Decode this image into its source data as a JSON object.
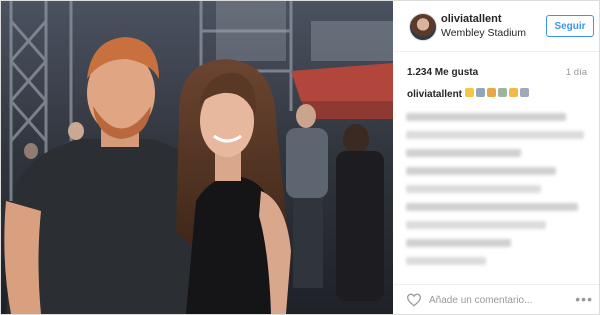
{
  "post": {
    "photo_alt_icon": "photo-icon",
    "header": {
      "username": "oliviatallent",
      "location": "Wembley Stadium",
      "follow_label": "Seguir"
    },
    "likes_text": "1.234 Me gusta",
    "time_ago": "1 día",
    "caption_username": "oliviatallent",
    "caption_emojis": [
      "emoji-face",
      "emoji-image",
      "emoji-face",
      "emoji-image",
      "emoji-face",
      "emoji-image"
    ],
    "comment_placeholder": "Añade un comentario...",
    "more_label": "•••",
    "colors": {
      "link_blue": "#3897f0",
      "text": "#262626",
      "muted": "#999999"
    }
  }
}
